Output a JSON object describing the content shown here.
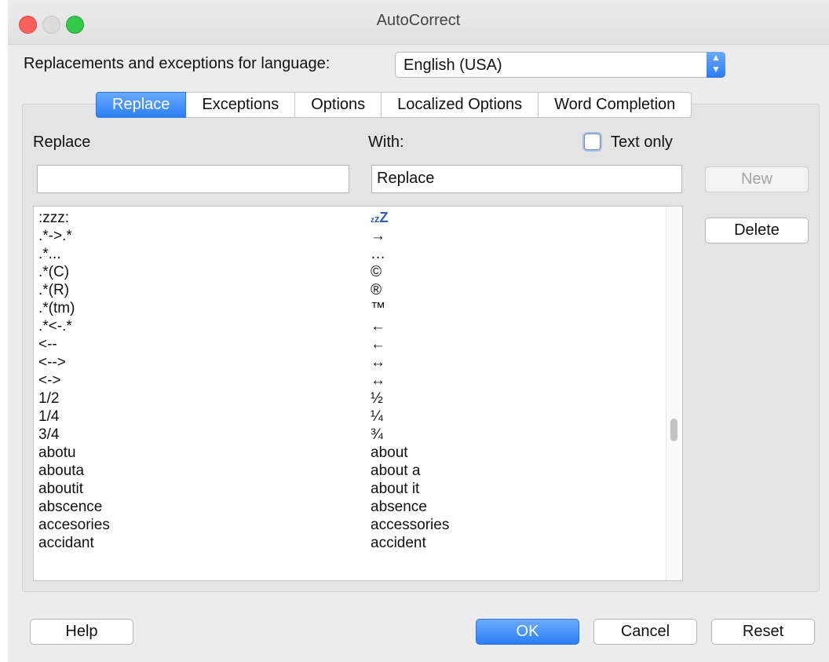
{
  "window": {
    "title": "AutoCorrect"
  },
  "language": {
    "label": "Replacements and exceptions for language:",
    "value": "English (USA)"
  },
  "tabs": [
    {
      "label": "Replace",
      "active": true
    },
    {
      "label": "Exceptions",
      "active": false
    },
    {
      "label": "Options",
      "active": false
    },
    {
      "label": "Localized Options",
      "active": false
    },
    {
      "label": "Word Completion",
      "active": false
    }
  ],
  "form": {
    "replace_label": "Replace",
    "with_label": "With:",
    "text_only_label": "Text only",
    "text_only_checked": false,
    "replace_value": "",
    "with_value": "Replace"
  },
  "buttons": {
    "new": "New",
    "delete": "Delete",
    "help": "Help",
    "ok": "OK",
    "cancel": "Cancel",
    "reset": "Reset"
  },
  "list": {
    "rows": [
      {
        "from": ":zzz:",
        "to": "zzZ"
      },
      {
        "from": ".*->.*",
        "to": "→"
      },
      {
        "from": ".*...",
        "to": "…"
      },
      {
        "from": ".*(C)",
        "to": "©"
      },
      {
        "from": ".*(R)",
        "to": "®"
      },
      {
        "from": ".*(tm)",
        "to": "™"
      },
      {
        "from": ".*<-.*",
        "to": "←"
      },
      {
        "from": "<--",
        "to": "←"
      },
      {
        "from": "<-->",
        "to": "↔"
      },
      {
        "from": "<->",
        "to": "↔"
      },
      {
        "from": "1/2",
        "to": "½"
      },
      {
        "from": "1/4",
        "to": "¼"
      },
      {
        "from": "3/4",
        "to": "¾"
      },
      {
        "from": "abotu",
        "to": "about"
      },
      {
        "from": "abouta",
        "to": "about a"
      },
      {
        "from": "aboutit",
        "to": "about it"
      },
      {
        "from": "abscence",
        "to": "absence"
      },
      {
        "from": "accesories",
        "to": "accessories"
      },
      {
        "from": "accidant",
        "to": "accident"
      }
    ]
  },
  "colors": {
    "accent": "#2c7ef7",
    "close": "#fc605c",
    "maximize": "#34c84a"
  }
}
